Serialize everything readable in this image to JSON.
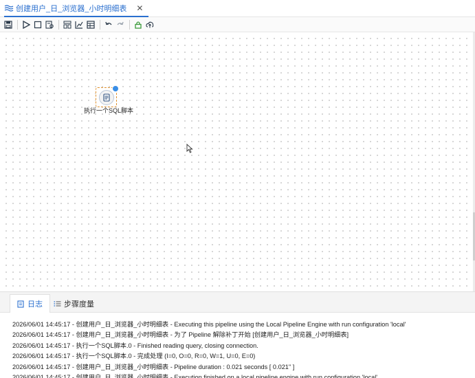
{
  "tab": {
    "title": "创建用户_日_浏览器_小时明细表",
    "close": "✕"
  },
  "toolbar": {
    "icons": [
      "save-icon",
      "run-icon",
      "stop-icon",
      "preview-icon",
      "align-icon",
      "chart-icon",
      "table-icon",
      "undo-icon",
      "redo-icon",
      "lock-icon",
      "upload-icon"
    ]
  },
  "canvas": {
    "node": {
      "label": "执行一个SQL脚本",
      "icon": "sql-script-icon"
    }
  },
  "panel": {
    "tabs": [
      {
        "label": "日志"
      },
      {
        "label": "步骤度量"
      }
    ],
    "log": [
      "2026/06/01 14:45:17 - 创建用户_日_浏览器_小时明细表 - Executing this pipeline using the Local Pipeline Engine with run configuration 'local'",
      "2026/06/01 14:45:17 - 创建用户_日_浏览器_小时明细表 - 为了 Pipeline 解除补丁开始 [创建用户_日_浏览器_小时明细表]",
      "2026/06/01 14:45:17 - 执行一个SQL脚本.0 - Finished reading query, closing connection.",
      "2026/06/01 14:45:17 - 执行一个SQL脚本.0 - 完成处理 (I=0, O=0, R=0, W=1, U=0, E=0)",
      "2026/06/01 14:45:17 - 创建用户_日_浏览器_小时明细表 - Pipeline duration : 0.021 seconds [  0.021\" ]",
      "2026/06/01 14:45:17 - 创建用户_日_浏览器_小时明细表 - Execution finished on a local pipeline engine with run configuration 'local'"
    ]
  },
  "colors": {
    "accent": "#2a6fcf",
    "node_border": "#e0922f"
  }
}
